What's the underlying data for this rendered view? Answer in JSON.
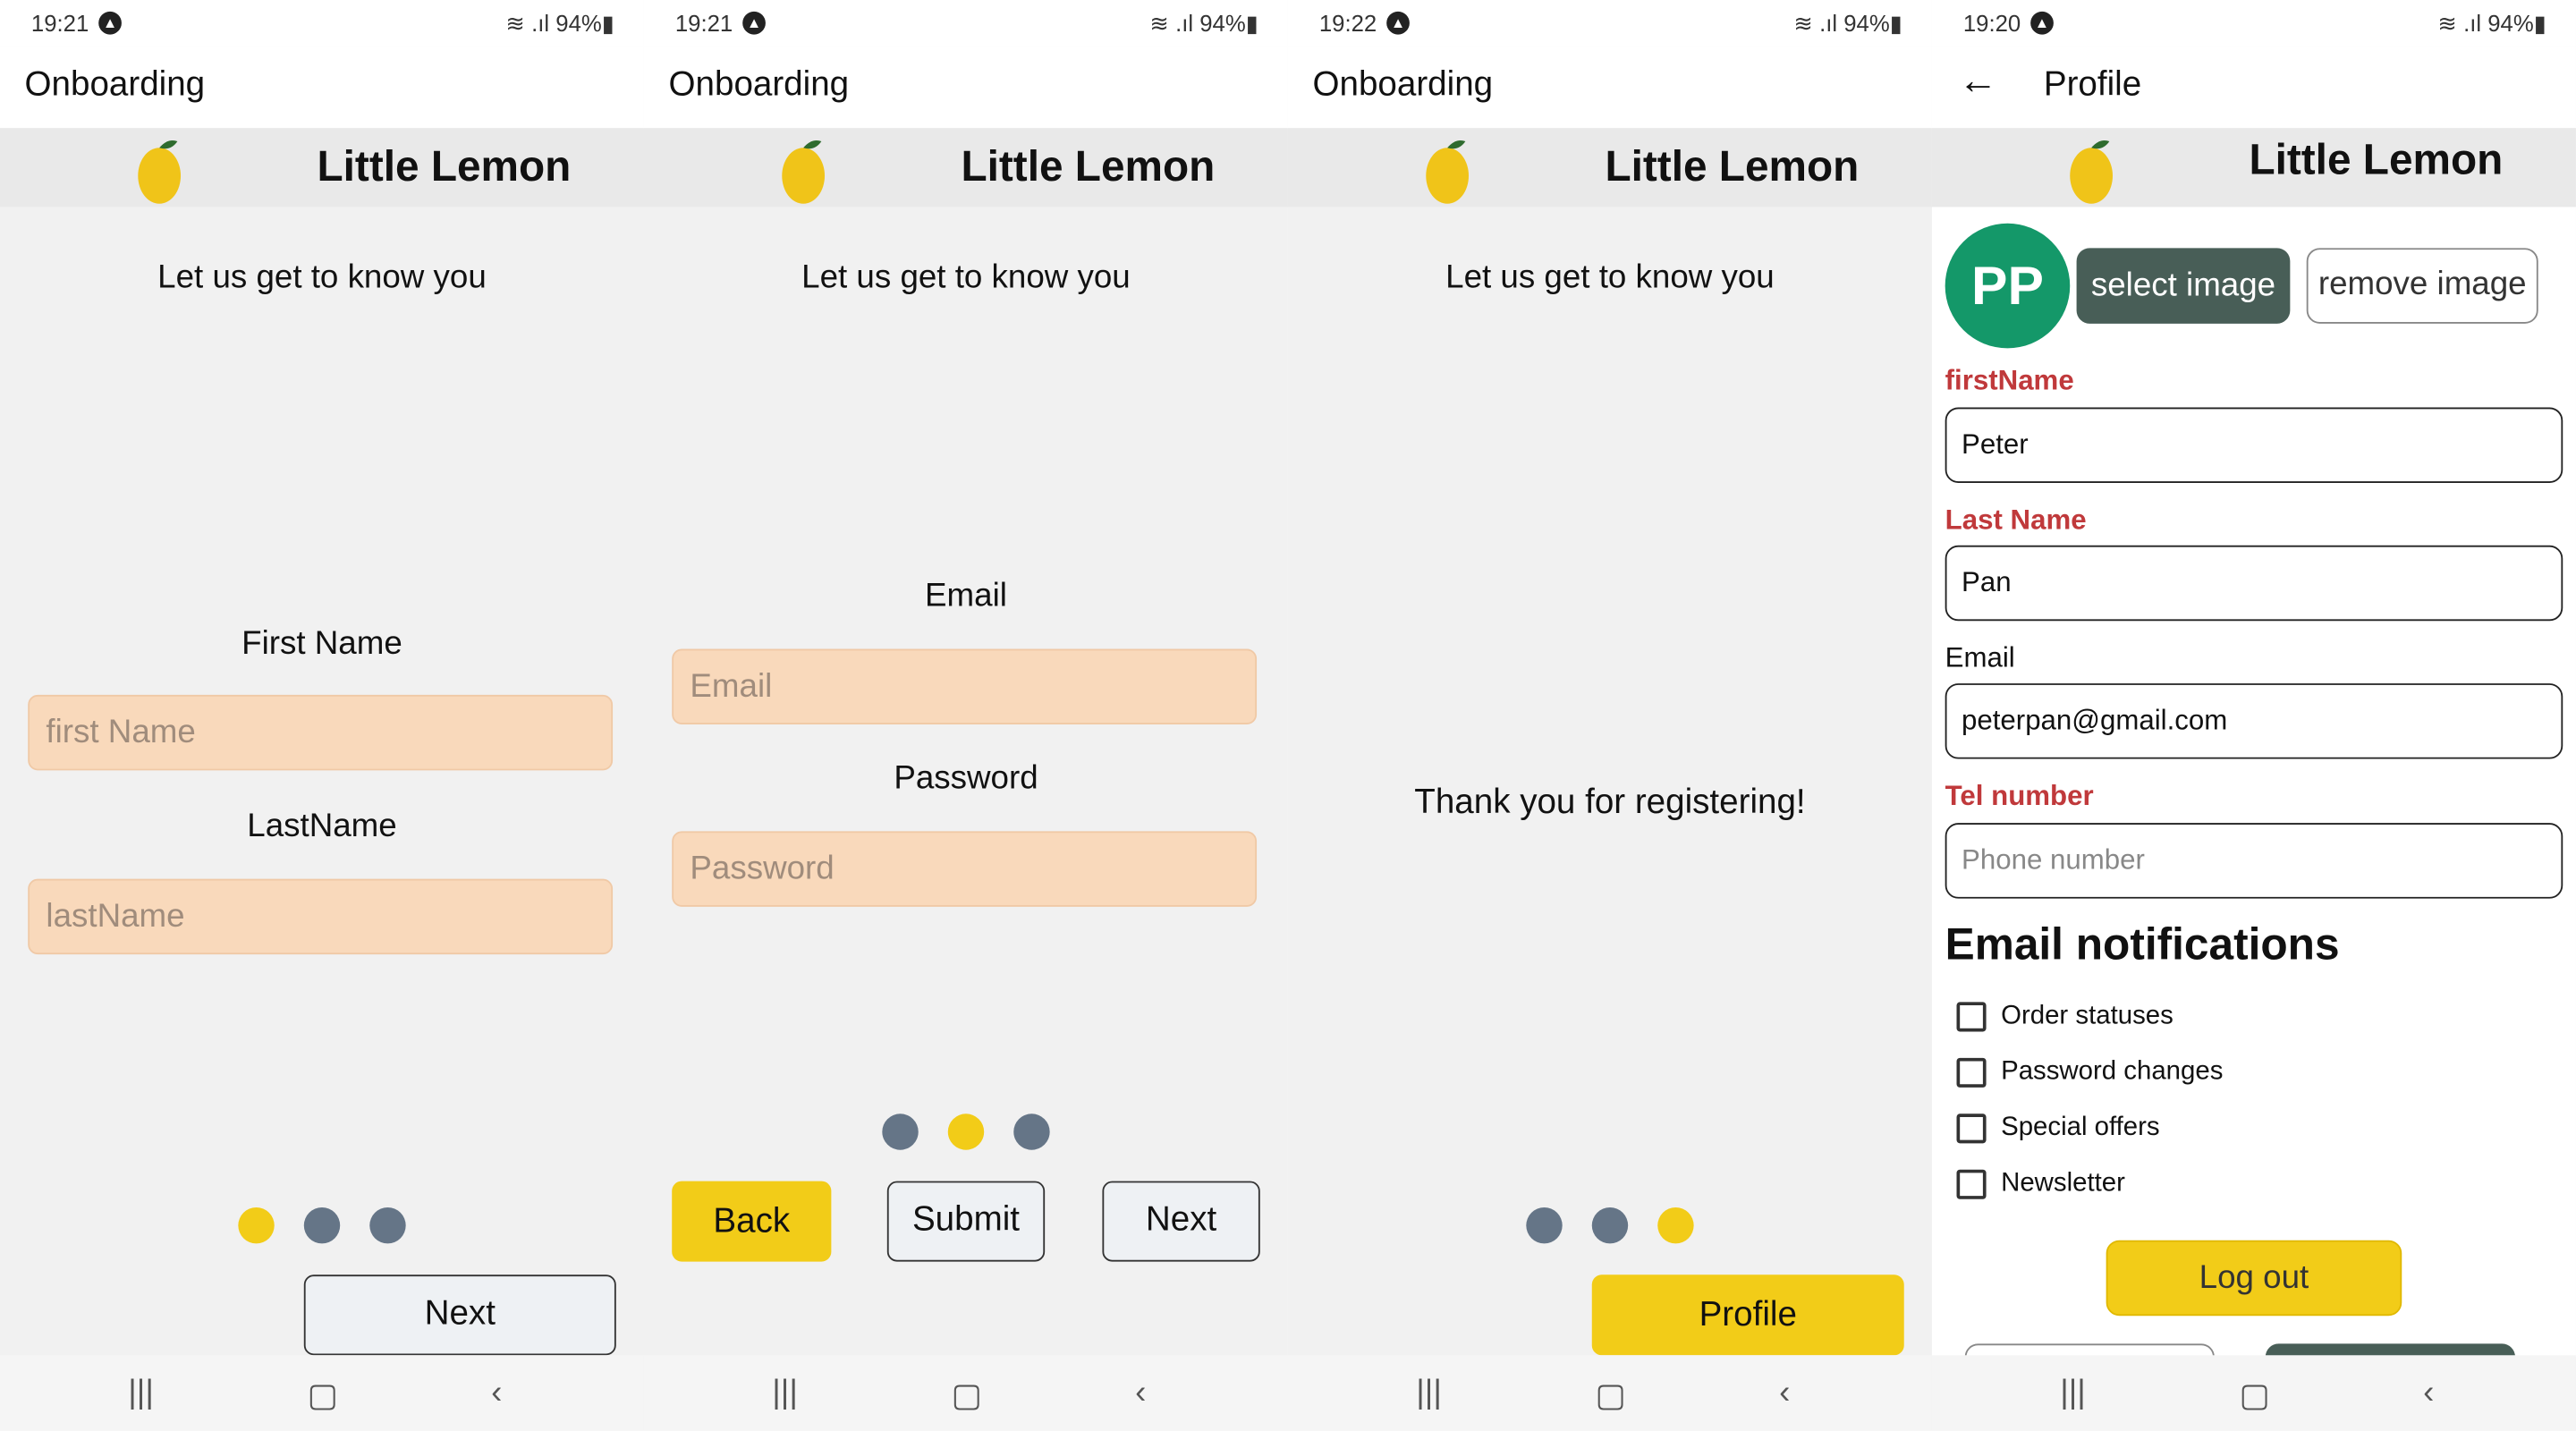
{
  "screens": [
    {
      "status": {
        "time": "19:21",
        "battery": "94%"
      },
      "appbar_title": "Onboarding",
      "brand": "Little Lemon",
      "subtitle": "Let us get to know you",
      "first_label": "First Name",
      "first_placeholder": "first Name",
      "last_label": "LastName",
      "last_placeholder": "lastName",
      "next_label": "Next",
      "active_step": 1
    },
    {
      "status": {
        "time": "19:21",
        "battery": "94%"
      },
      "appbar_title": "Onboarding",
      "brand": "Little Lemon",
      "subtitle": "Let us get to know you",
      "email_label": "Email",
      "email_placeholder": "Email",
      "password_label": "Password",
      "password_placeholder": "Password",
      "back_label": "Back",
      "submit_label": "Submit",
      "next_label": "Next",
      "active_step": 2
    },
    {
      "status": {
        "time": "19:22",
        "battery": "94%"
      },
      "appbar_title": "Onboarding",
      "brand": "Little Lemon",
      "subtitle": "Let us get to know you",
      "message": "Thank you for registering!",
      "profile_label": "Profile",
      "active_step": 3
    },
    {
      "status": {
        "time": "19:20",
        "battery": "94%"
      },
      "appbar_title": "Profile",
      "brand": "Little Lemon",
      "avatar_initials": "PP",
      "select_image": "select image",
      "remove_image": "remove image",
      "first_label": "firstName",
      "first_value": "Peter",
      "last_label": "Last Name",
      "last_value": "Pan",
      "email_label": "Email",
      "email_value": "peterpan@gmail.com",
      "tel_label": "Tel number",
      "tel_placeholder": "Phone number",
      "notifications_title": "Email notifications",
      "notifications": [
        "Order statuses",
        "Password changes",
        "Special offers",
        "Newsletter"
      ],
      "logout_label": "Log out"
    }
  ],
  "colors": {
    "accent": "#f2cc18",
    "inactive_dot": "#657587",
    "peach": "#f9d9bb",
    "avatar": "#149869",
    "error": "#c0393b"
  }
}
